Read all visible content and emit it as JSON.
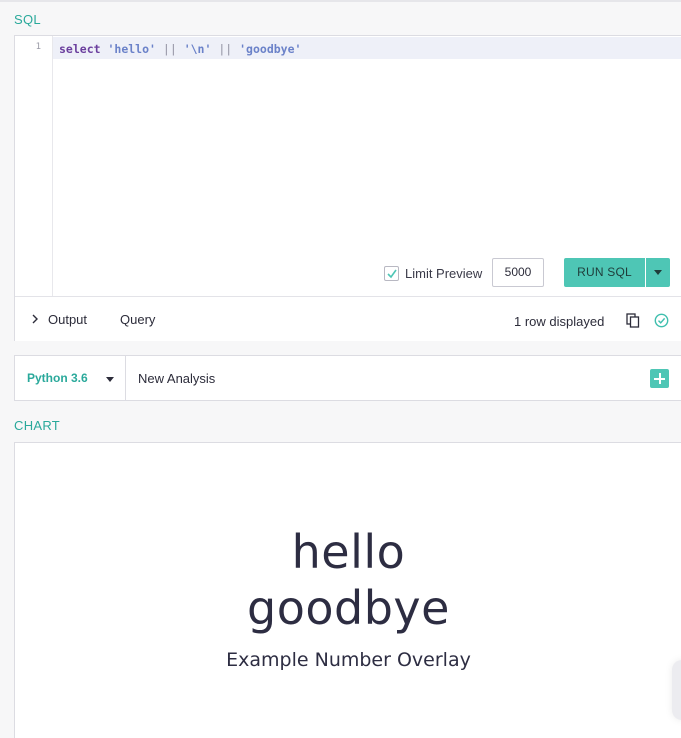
{
  "sql_section": {
    "label": "SQL"
  },
  "editor": {
    "line_number": "1",
    "tokens": {
      "kw": "select",
      "s1": "'hello'",
      "op1": "||",
      "s2": "'\\n'",
      "op2": "||",
      "s3": "'goodbye'"
    }
  },
  "limit_preview": {
    "label": "Limit Preview",
    "checked": true,
    "value": "5000"
  },
  "run_button": {
    "label": "RUN SQL"
  },
  "output_bar": {
    "tabs": [
      "Output",
      "Query"
    ],
    "status": "1 row displayed"
  },
  "python_bar": {
    "kernel": "Python 3.6",
    "analysis_name": "New Analysis"
  },
  "chart_section": {
    "label": "CHART"
  },
  "chart": {
    "lines": [
      "hello",
      "goodbye"
    ],
    "caption": "Example Number Overlay"
  },
  "colors": {
    "accent": "#4ec6b5",
    "accent_text": "#2aa99b",
    "text": "#2d2d42"
  },
  "icons": [
    "chevron-right-icon",
    "copy-icon",
    "check-circle-icon",
    "caret-down-icon",
    "plus-icon"
  ]
}
